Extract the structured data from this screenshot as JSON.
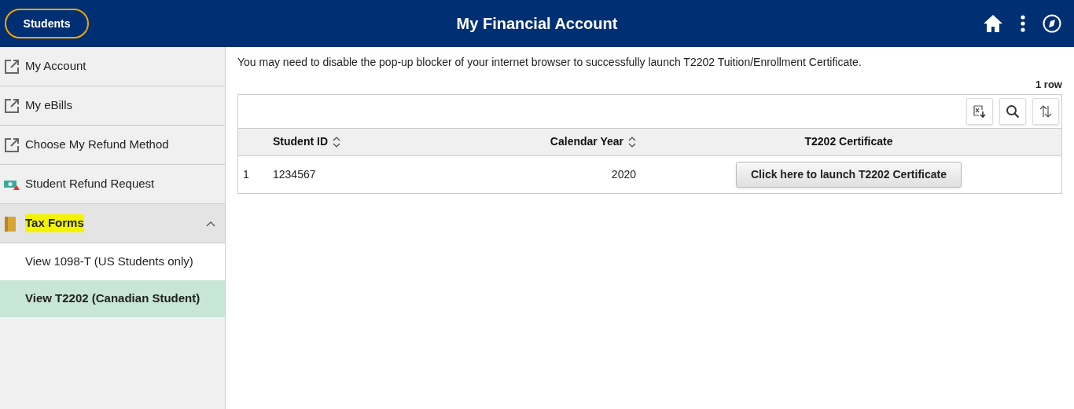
{
  "header": {
    "home_button": "Students",
    "title": "My Financial Account"
  },
  "sidebar": {
    "items": [
      {
        "kind": "link",
        "label": "My Account",
        "highlighted": false
      },
      {
        "kind": "link",
        "label": "My eBills",
        "highlighted": false
      },
      {
        "kind": "link",
        "label": "Choose My Refund Method",
        "highlighted": false
      },
      {
        "kind": "refund",
        "label": "Student Refund Request",
        "highlighted": false
      },
      {
        "kind": "folder",
        "label": "Tax Forms",
        "expanded": true,
        "highlighted": true,
        "children": [
          {
            "label": "View 1098-T (US Students only)",
            "selected": false
          },
          {
            "label": "View T2202 (Canadian Student)",
            "selected": true
          }
        ]
      }
    ]
  },
  "notice": "You may need to disable the pop-up blocker of your internet browser to successfully launch T2202 Tuition/Enrollment Certificate.",
  "table": {
    "row_count": "1 row",
    "columns": [
      {
        "label": "Student ID",
        "sortable": true
      },
      {
        "label": "Calendar Year",
        "sortable": true
      },
      {
        "label": "T2202 Certificate",
        "sortable": false
      }
    ],
    "rows": [
      {
        "number": "1",
        "student_id": "1234567",
        "calendar_year": "2020",
        "action": "Click here to launch T2202 Certificate"
      }
    ]
  }
}
